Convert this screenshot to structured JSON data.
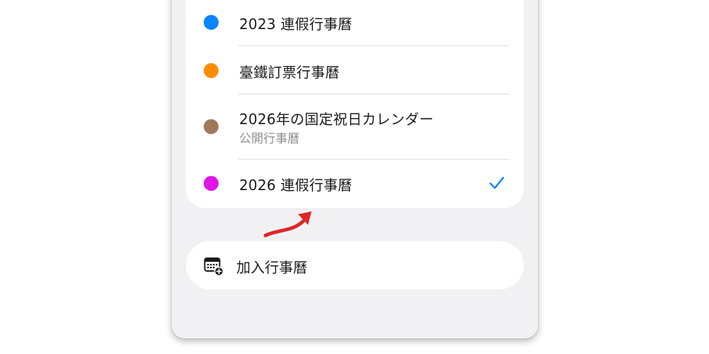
{
  "calendars": [
    {
      "title": "2023 連假行事曆",
      "color": "#0a84ff",
      "subtitle": "",
      "checked": false
    },
    {
      "title": "臺鐵訂票行事曆",
      "color": "#ff8c00",
      "subtitle": "",
      "checked": false
    },
    {
      "title": "2026年の国定祝日カレンダー",
      "color": "#a2785a",
      "subtitle": "公開行事曆",
      "checked": false
    },
    {
      "title": "2026 連假行事曆",
      "color": "#e015e6",
      "subtitle": "",
      "checked": true
    }
  ],
  "colors": {
    "accent": "#0a84ff",
    "annotation_arrow": "#e0252b"
  },
  "add_calendar": {
    "label": "加入行事曆",
    "icon": "calendar-add-icon"
  },
  "selected_indicator_icon": "checkmark-icon"
}
